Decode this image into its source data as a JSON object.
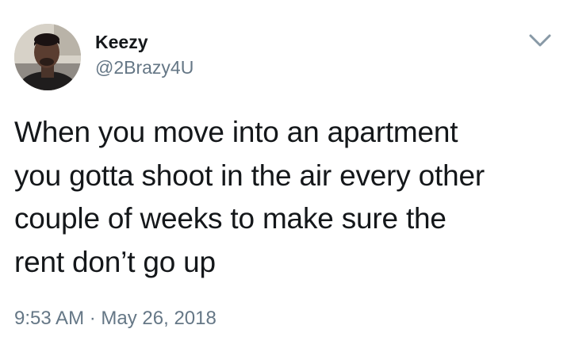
{
  "author": {
    "display_name": "Keezy",
    "handle": "@2Brazy4U",
    "avatar_icon": "profile-photo"
  },
  "menu": {
    "icon": "chevron-down-icon"
  },
  "tweet": {
    "lines": [
      "When you move into an apartment",
      "you gotta shoot in the air every other",
      "couple of weeks to make sure the",
      "rent don’t go up"
    ]
  },
  "meta": {
    "time": "9:53 AM",
    "separator": "·",
    "date": "May 26, 2018"
  },
  "colors": {
    "text": "#14171a",
    "secondary": "#657786",
    "background": "#ffffff"
  }
}
